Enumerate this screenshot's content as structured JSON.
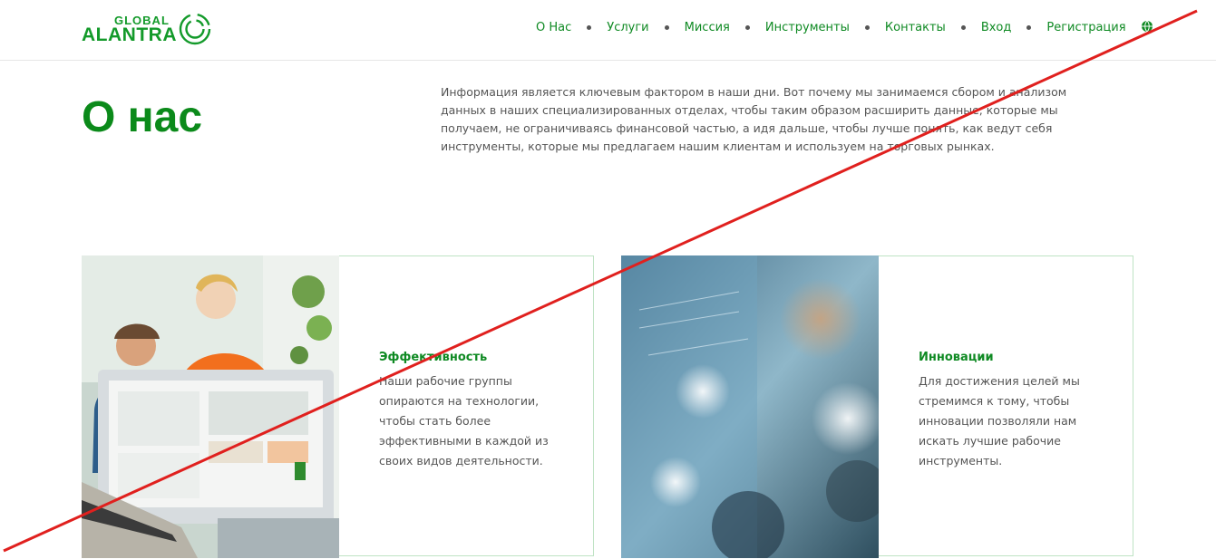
{
  "header": {
    "logo": {
      "top": "GLOBAL",
      "bottom": "ALANTRA"
    },
    "nav": [
      {
        "label": "О Нас"
      },
      {
        "label": "Услуги"
      },
      {
        "label": "Миссия"
      },
      {
        "label": "Инструменты"
      },
      {
        "label": "Контакты"
      },
      {
        "label": "Вход"
      },
      {
        "label": "Регистрация"
      }
    ],
    "language_icon": "globe-icon"
  },
  "main": {
    "title": "О нас",
    "intro": "Информация является ключевым фактором в наши дни. Вот почему мы занимаемся сбором и анализом данных в наших специализированных отделах, чтобы таким образом расширить данные, которые мы получаем, не ограничиваясь финансовой частью, а идя дальше, чтобы лучше понять, как ведут себя инструменты, которые мы предлагаем нашим клиентам и используем на торговых рынках."
  },
  "cards": [
    {
      "title": "Эффективность",
      "text": "Наши рабочие группы опираются на технологии, чтобы стать более эффективными в каждой из своих видов деятельности."
    },
    {
      "title": "Инновации",
      "text": "Для достижения целей мы стремимся к тому, чтобы инновации позволяли нам искать лучшие рабочие инструменты."
    }
  ],
  "colors": {
    "brand_green": "#0b8a1a",
    "card_border": "#bfe3c4",
    "strike_line": "#e0201e"
  }
}
